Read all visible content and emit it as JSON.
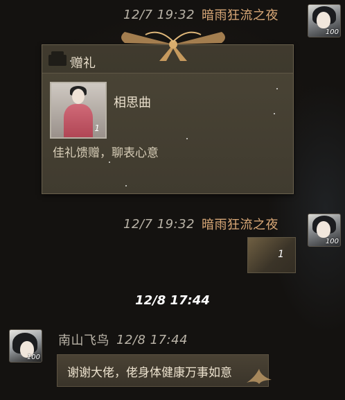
{
  "messages": [
    {
      "timestamp": "12/7 19:32",
      "sender": "暗雨狂流之夜",
      "avatar_level": "100",
      "gift": {
        "header": "赠礼",
        "item_name": "相思曲",
        "item_qty": "1",
        "message": "佳礼馈赠，聊表心意"
      }
    },
    {
      "timestamp": "12/7 19:32",
      "sender": "暗雨狂流之夜",
      "avatar_level": "100",
      "small_item_qty": "1"
    }
  ],
  "date_separator": "12/8 17:44",
  "reply": {
    "sender": "南山飞鸟",
    "timestamp": "12/8 17:44",
    "avatar_level": "100",
    "text": "谢谢大佬，佬身体健康万事如意"
  },
  "colors": {
    "background": "#141210",
    "name_accent": "#d9a877",
    "timestamp": "#b9b3a7",
    "bubble": "#3a342a"
  }
}
